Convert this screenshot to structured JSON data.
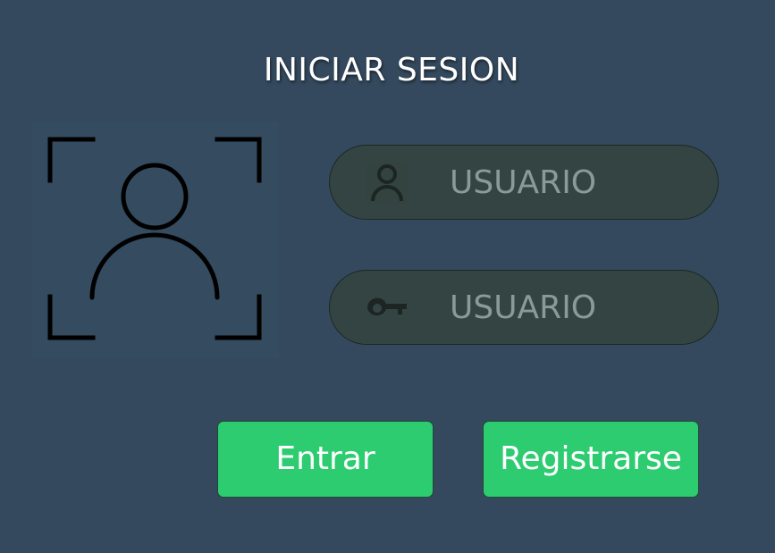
{
  "app": {
    "title": "INICIAR SESION"
  },
  "avatar": {
    "icon": "face-scan-user-icon"
  },
  "fields": {
    "username": {
      "icon": "user-icon",
      "text": "USUARIO"
    },
    "password": {
      "icon": "key-icon",
      "text": "USUARIO"
    }
  },
  "buttons": {
    "login_label": "Entrar",
    "register_label": "Registrarse"
  },
  "colors": {
    "background": "#34495e",
    "field_background": "#344443",
    "button": "#2ecc71",
    "title_text": "#ffffff"
  }
}
